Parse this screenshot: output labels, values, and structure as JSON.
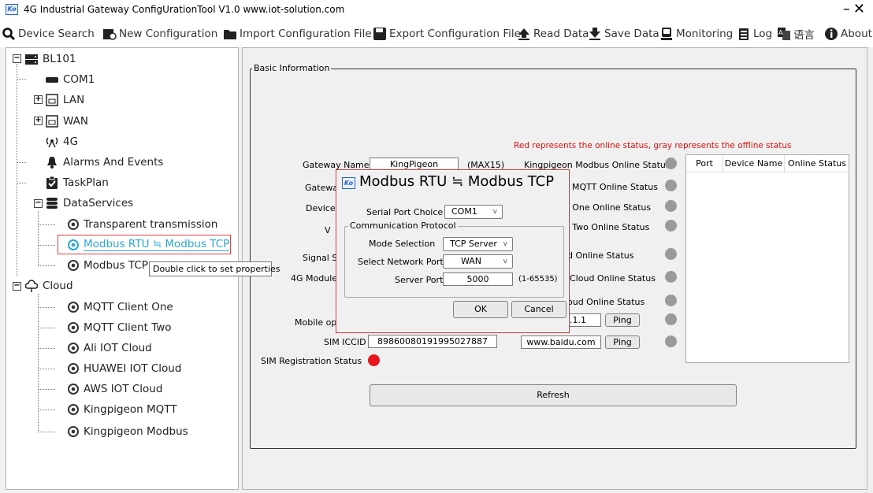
{
  "window": {
    "title": "4G Industrial Gateway ConfigUrationTool V1.0 www.iot-solution.com",
    "app_icon_text": "Ko",
    "minimize": "–",
    "close": "✕"
  },
  "toolbar": {
    "device_search": "Device Search",
    "new_configuration": "New Configuration",
    "import_configuration": "Import Configuration File",
    "export_configuration": "Export Configuration File",
    "read_data": "Read Data",
    "save_data": "Save Data",
    "monitoring": "Monitoring",
    "log": "Log",
    "language": "语言",
    "about": "About"
  },
  "tree": {
    "root": "BL101",
    "com1": "COM1",
    "lan": "LAN",
    "wan": "WAN",
    "g4": "4G",
    "alarms": "Alarms And Events",
    "taskplan": "TaskPlan",
    "dataservices": "DataServices",
    "transparent": "Transparent transmission",
    "modbus_rtu_tcp": "Modbus RTU ≒ Modbus TCP",
    "modbus_tcp": "Modbus TCP",
    "cloud": "Cloud",
    "mqtt_one": "MQTT Client One",
    "mqtt_two": "MQTT Client Two",
    "ali": "Ali IOT Cloud",
    "huawei": "HUAWEI IOT Cloud",
    "aws": "AWS IOT Cloud",
    "kp_mqtt": "Kingpigeon MQTT",
    "kp_modbus": "Kingpigeon Modbus"
  },
  "tooltip": "Double click to set properties",
  "basic": {
    "legend": "Basic Information",
    "note": "Red represents the online status, gray represents the offline status",
    "gateway_name_label": "Gateway Name",
    "gateway_name_value": "KingPigeon",
    "gateway_name_max": "(MAX15)",
    "gateway_partial_label": "Gatewa",
    "device_partial_label": "Device",
    "v_partial_label": "V",
    "signal_partial_label": "Signal St",
    "module_partial_label": "4G Module",
    "mobile_partial_label": "Mobile ope",
    "sim_iccid_label": "SIM ICCID",
    "sim_iccid_value": "89860080191995027887",
    "sim_reg_label": "SIM Registration Status",
    "ping_host_1": ".1.1",
    "ping_host_2": "www.baidu.com",
    "ping_label": "Ping",
    "refresh": "Refresh",
    "status_labels": [
      "Kingpigeon Modbus Online Status",
      "MQTT Online Status",
      ": One Online Status",
      ": Two Online Status",
      "d Online Status",
      "Cloud Online Status",
      "oud Online Status"
    ],
    "table_headers": [
      "Port",
      "Device Name",
      "Online Status"
    ]
  },
  "dialog": {
    "title": "Modbus RTU ≒ Modbus TCP",
    "icon_text": "Ko",
    "serial_port_label": "Serial Port Choice",
    "serial_port_value": "COM1",
    "protocol_legend": "Communication Protocol",
    "mode_label": "Mode Selection",
    "mode_value": "TCP Server",
    "network_label": "Select Network Port",
    "network_value": "WAN",
    "server_port_label": "Server Port",
    "server_port_value": "5000",
    "server_port_range": "(1-65535)",
    "ok": "OK",
    "cancel": "Cancel"
  },
  "colors": {
    "online": "#e8171c",
    "offline": "#9a9a9a",
    "tree_selected": "#2aa6d6",
    "note": "#e01010"
  }
}
